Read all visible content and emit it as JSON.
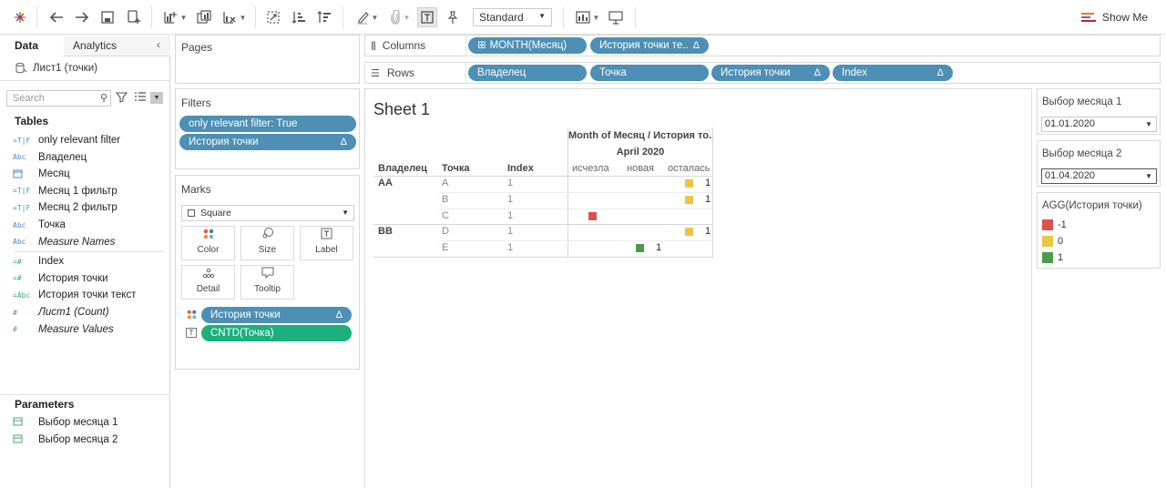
{
  "toolbar": {
    "mark_type_dropdown": "Standard",
    "show_me_label": "Show Me"
  },
  "left_pane": {
    "tabs": [
      "Data",
      "Analytics"
    ],
    "datasource": "Лист1 (точки)",
    "search_placeholder": "Search",
    "tables_header": "Tables",
    "dimensions": [
      {
        "icon": "=T|F",
        "name": "only relevant filter",
        "italic": false
      },
      {
        "icon": "Abc",
        "name": "Владелец",
        "italic": false
      },
      {
        "icon": "calendar",
        "name": "Месяц",
        "italic": false
      },
      {
        "icon": "=T|F",
        "name": "Месяц 1 фильтр",
        "italic": false
      },
      {
        "icon": "=T|F",
        "name": "Месяц 2 фильтр",
        "italic": false
      },
      {
        "icon": "Abc",
        "name": "Точка",
        "italic": false
      },
      {
        "icon": "Abc",
        "name": "Measure Names",
        "italic": true
      }
    ],
    "measures": [
      {
        "icon": "=#",
        "name": "Index",
        "italic": false
      },
      {
        "icon": "=#",
        "name": "История точки",
        "italic": false
      },
      {
        "icon": "=Abc",
        "name": "История точки текст",
        "italic": false
      },
      {
        "icon": "#",
        "name": "Лист1 (Count)",
        "italic": true
      },
      {
        "icon": "#",
        "name": "Measure Values",
        "italic": true
      }
    ],
    "parameters_header": "Parameters",
    "parameters": [
      "Выбор месяца 1",
      "Выбор месяца 2"
    ]
  },
  "pages_card": {
    "title": "Pages"
  },
  "filters_card": {
    "title": "Filters",
    "pills": [
      {
        "label": "only relevant filter: True",
        "delta": false
      },
      {
        "label": "История точки",
        "delta": true
      }
    ]
  },
  "marks_card": {
    "title": "Marks",
    "type": "Square",
    "buttons": [
      "Color",
      "Size",
      "Label",
      "Detail",
      "Tooltip"
    ],
    "pills": [
      {
        "label": "История точки",
        "delta": true
      },
      {
        "label": "CNTD(Точка)",
        "delta": false
      }
    ]
  },
  "columns_shelf": {
    "label": "Columns",
    "pills": [
      {
        "label": "MONTH(Месяц)",
        "delta": false
      },
      {
        "label": "История точки те..",
        "delta": true
      }
    ]
  },
  "rows_shelf": {
    "label": "Rows",
    "pills": [
      {
        "label": "Владелец",
        "delta": false
      },
      {
        "label": "Точка",
        "delta": false
      },
      {
        "label": "История точки",
        "delta": true
      },
      {
        "label": "Index",
        "delta": true
      }
    ]
  },
  "sheet": {
    "title": "Sheet 1",
    "col_header_top": "Month of Месяц  /  История то..",
    "col_header_month": "April 2020",
    "row_headers": [
      "Владелец",
      "Точка",
      "Index"
    ],
    "col_categories": [
      "исчезла",
      "новая",
      "осталась"
    ],
    "rows": [
      {
        "owner": "AA",
        "point": "A",
        "index": "1",
        "category": "осталась",
        "value": "1",
        "color": "#e8c547"
      },
      {
        "owner": "",
        "point": "B",
        "index": "1",
        "category": "осталась",
        "value": "1",
        "color": "#e8c547"
      },
      {
        "owner": "",
        "point": "C",
        "index": "1",
        "category": "исчезла",
        "value": "",
        "color": "#d9534f"
      },
      {
        "owner": "BB",
        "point": "D",
        "index": "1",
        "category": "осталась",
        "value": "1",
        "color": "#e8c547"
      },
      {
        "owner": "",
        "point": "E",
        "index": "1",
        "category": "новая",
        "value": "1",
        "color": "#4e9a4b"
      }
    ]
  },
  "right_pane": {
    "param1": {
      "title": "Выбор месяца 1",
      "value": "01.01.2020"
    },
    "param2": {
      "title": "Выбор месяца 2",
      "value": "01.04.2020"
    },
    "legend": {
      "title": "AGG(История точки)",
      "items": [
        {
          "label": "-1",
          "color": "#d9534f"
        },
        {
          "label": "0",
          "color": "#e8c547"
        },
        {
          "label": "1",
          "color": "#4e9a4b"
        }
      ]
    }
  }
}
